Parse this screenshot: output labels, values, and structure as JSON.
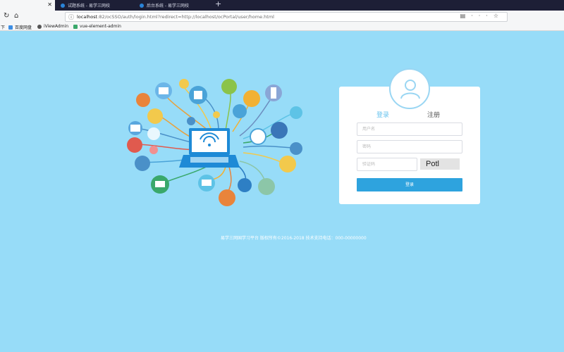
{
  "browser": {
    "tabs": [
      {
        "label": "",
        "close": "✕"
      },
      {
        "label": "试题系统 - 易学三网校"
      },
      {
        "label": "后台系统 - 易学三网校"
      }
    ],
    "new_tab": "+",
    "url_host": "localhost",
    "url_rest": ":82/ocSSO/auth/login.html?redirect=http://localhost/ocPortal/user/home.html",
    "bookmarks": {
      "lead": "下",
      "items": [
        "百度网盘",
        "iViewAdmin",
        "vue-element-admin"
      ]
    }
  },
  "login": {
    "tab_login": "登录",
    "tab_register": "注册",
    "username_placeholder": "用户名",
    "password_placeholder": "密码",
    "captcha_placeholder": "验证码",
    "captcha_text": "Potl",
    "submit_label": "登录"
  },
  "footer": {
    "text": "易学三网国学习平台 版权所有©2016-2018 技术支持电话：000-00000000"
  },
  "colors": {
    "background": "#97dcf8",
    "accent": "#2ea3de",
    "active_tab": "#67c3ee"
  }
}
